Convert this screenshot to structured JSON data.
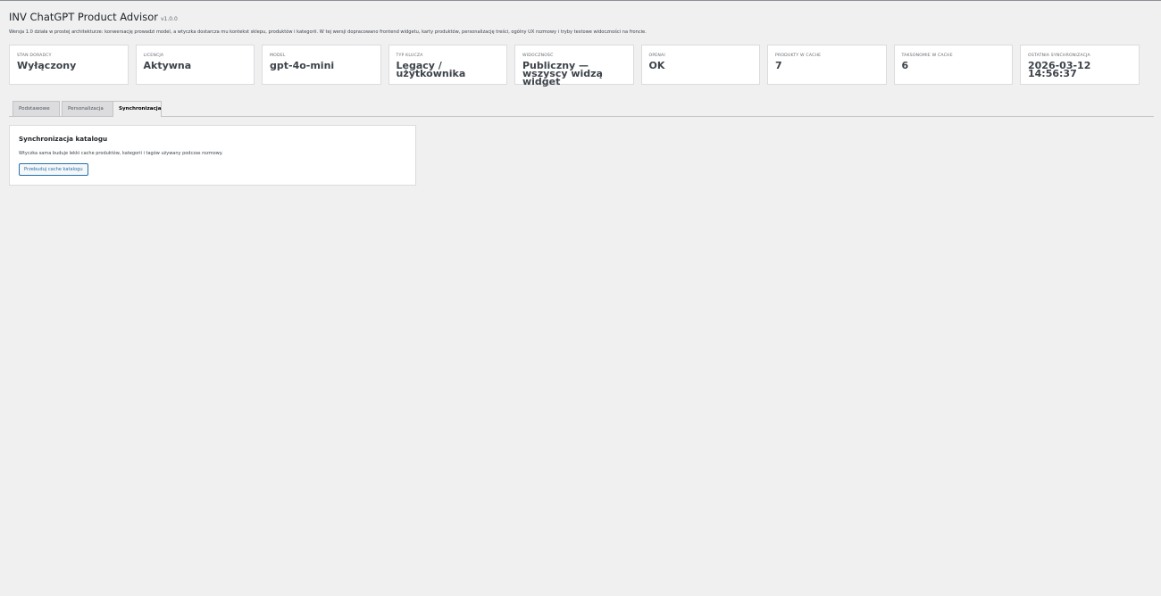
{
  "header": {
    "title": "INV ChatGPT Product Advisor",
    "version": "v1.0.0",
    "description": "Wersja 1.0 działa w prostej architekturze: konwersację prowadzi model, a wtyczka dostarcza mu kontekst sklepu, produktów i kategorii. W tej wersji dopracowano frontend widgetu, karty produktów, personalizację treści, ogólny UX rozmowy i tryby testowe widoczności na froncie."
  },
  "stats": [
    {
      "label": "Stan doradcy",
      "value": "Wyłączony"
    },
    {
      "label": "Licencja",
      "value": "Aktywna"
    },
    {
      "label": "Model",
      "value": "gpt-4o-mini"
    },
    {
      "label": "Typ klucza",
      "value": "Legacy / użytkownika"
    },
    {
      "label": "Widoczność",
      "value": "Publiczny — wszyscy widzą widget"
    },
    {
      "label": "OpenAI",
      "value": "OK"
    },
    {
      "label": "Produkty w cache",
      "value": "7"
    },
    {
      "label": "Taksonomie w cache",
      "value": "6"
    },
    {
      "label": "Ostatnia synchronizacja",
      "value": "2026-03-12 14:56:37"
    }
  ],
  "tabs": [
    {
      "label": "Podstawowe"
    },
    {
      "label": "Personalizacja"
    },
    {
      "label": "Synchronizacja"
    }
  ],
  "sync_card": {
    "title": "Synchronizacja katalogu",
    "text": "Wtyczka sama buduje lekki cache produktów, kategorii i tagów używany podczas rozmowy.",
    "button_label": "Przebuduj cache katalogu"
  }
}
